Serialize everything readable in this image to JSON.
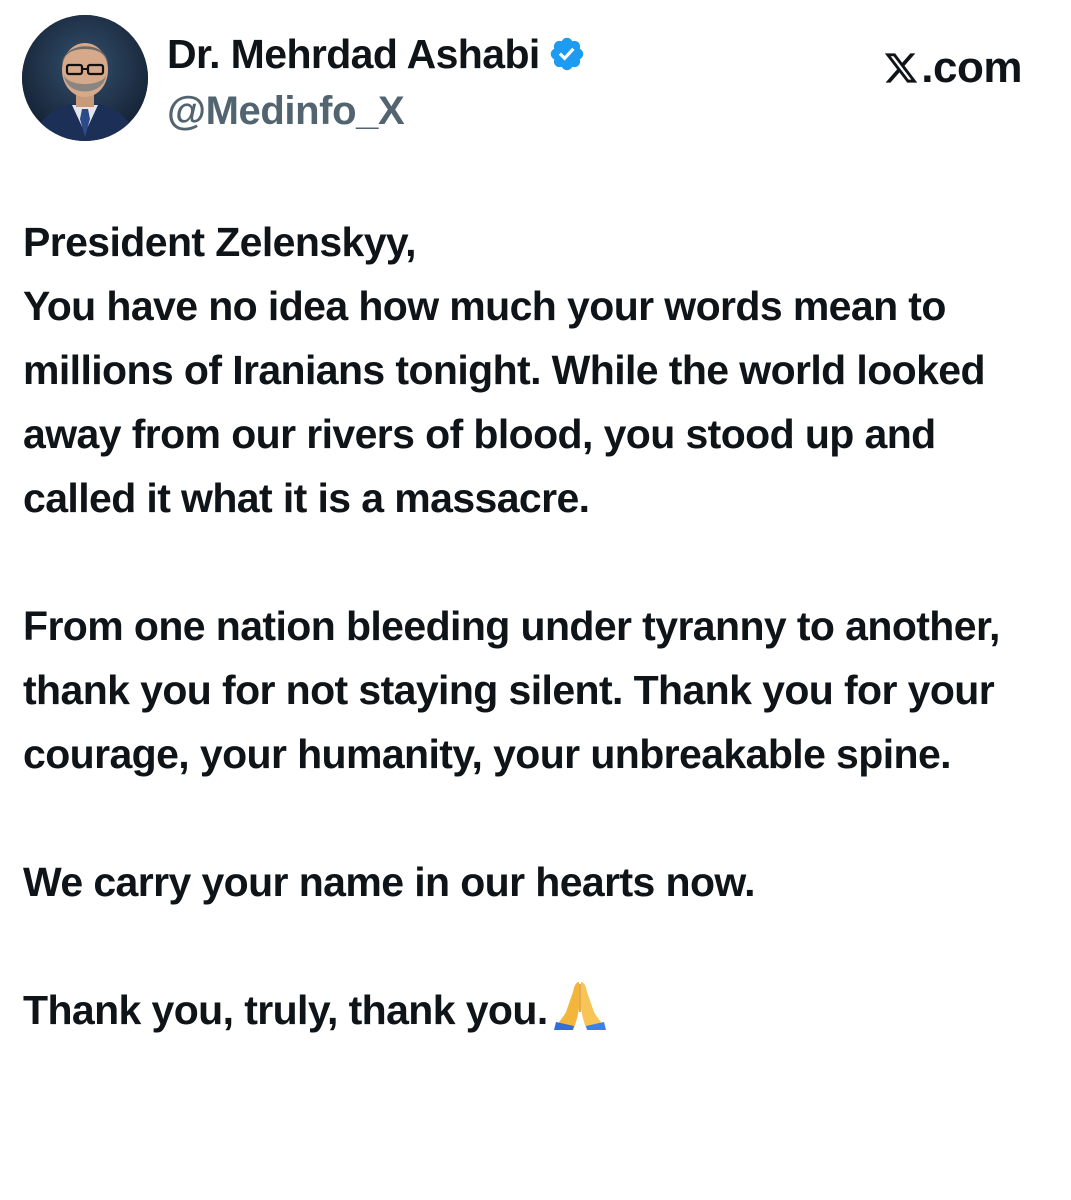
{
  "post": {
    "author": {
      "display_name": "Dr. Mehrdad Ashabi",
      "handle": "@Medinfo_X",
      "verified": true,
      "verified_color": "#1d9bf0",
      "avatar_icon": "profile-photo"
    },
    "site_label": ".com",
    "paragraphs": [
      "President Zelenskyy,\nYou have no idea how much your words mean to millions of Iranians tonight. While the world looked away from our rivers of blood, you stood up and called it what it is a massacre.",
      "From one nation bleeding under tyranny to another, thank you for not staying silent. Thank you for your courage, your humanity, your unbreakable spine.",
      "We carry your name in our hearts now.",
      "Thank you, truly, thank you."
    ],
    "trailing_emoji": "folded-hands-icon"
  },
  "colors": {
    "text": "#0f1419",
    "secondary_text": "#536471",
    "background": "#ffffff"
  }
}
